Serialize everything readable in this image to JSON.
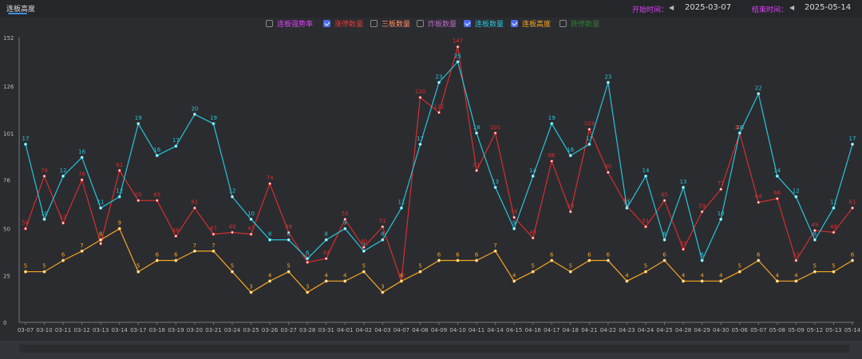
{
  "header": {
    "tab_label": "连板高度",
    "start_label": "开始时间：",
    "start_value": "2025-03-07",
    "end_label": "结束时间：",
    "end_value": "2025-05-14",
    "prev_icon": "caret-left-icon",
    "next_icon": "caret-right-icon"
  },
  "legend": [
    {
      "label": "连板强势率",
      "checked": false,
      "color": "#e040fb"
    },
    {
      "label": "涨停数量",
      "checked": true,
      "color": "#e53935"
    },
    {
      "label": "三板数量",
      "checked": false,
      "color": "#ff8a65"
    },
    {
      "label": "炸板数量",
      "checked": false,
      "color": "#ba68c8"
    },
    {
      "label": "连板数量",
      "checked": true,
      "color": "#26c6da"
    },
    {
      "label": "连板高度",
      "checked": true,
      "color": "#f5a623"
    },
    {
      "label": "跌停数量",
      "checked": false,
      "color": "#2e7d32"
    }
  ],
  "chart_data": {
    "type": "line",
    "ylim": [
      0,
      152
    ],
    "yticks": [
      "0",
      "25",
      "50",
      "76",
      "101",
      "126",
      "152"
    ],
    "grid": false,
    "categories": [
      "03-07",
      "03-10",
      "03-11",
      "03-12",
      "03-13",
      "03-14",
      "03-17",
      "03-18",
      "03-19",
      "03-20",
      "03-21",
      "03-24",
      "03-25",
      "03-26",
      "03-27",
      "03-28",
      "03-31",
      "04-01",
      "04-02",
      "04-03",
      "04-07",
      "04-08",
      "04-09",
      "04-10",
      "04-11",
      "04-14",
      "04-15",
      "04-16",
      "04-17",
      "04-18",
      "04-21",
      "04-22",
      "04-23",
      "04-24",
      "04-25",
      "04-28",
      "04-29",
      "04-30",
      "05-06",
      "05-07",
      "05-08",
      "05-09",
      "05-12",
      "05-13",
      "05-14"
    ],
    "series": [
      {
        "name": "涨停数量",
        "color": "#d32f2f",
        "values": [
          50,
          78,
          53,
          76,
          42,
          81,
          65,
          65,
          46,
          61,
          47,
          48,
          47,
          74,
          48,
          32,
          34,
          55,
          40,
          51,
          22,
          120,
          112,
          147,
          81,
          101,
          56,
          45,
          86,
          59,
          103,
          80,
          62,
          51,
          65,
          39,
          59,
          71,
          101,
          64,
          66,
          33,
          49,
          48,
          61
        ]
      },
      {
        "name": "连板数量",
        "color": "#26c6da",
        "values": [
          17,
          10,
          12,
          16,
          11,
          12,
          19,
          16,
          17,
          20,
          19,
          12,
          10,
          8,
          8,
          6,
          8,
          9,
          7,
          8,
          11,
          17,
          23,
          25,
          18,
          13,
          9,
          14,
          19,
          16,
          17,
          23,
          11,
          14,
          8,
          13,
          6,
          10,
          18,
          22,
          14,
          12,
          8,
          11,
          17
        ],
        "plot_values": [
          95,
          55,
          78,
          88,
          61,
          67,
          106,
          89,
          94,
          111,
          106,
          67,
          55,
          44,
          44,
          34,
          44,
          50,
          38,
          44,
          61,
          95,
          128,
          139,
          101,
          72,
          50,
          78,
          106,
          89,
          95,
          128,
          61,
          78,
          44,
          72,
          33,
          55,
          101,
          122,
          78,
          67,
          44,
          61,
          95
        ]
      },
      {
        "name": "连板高度",
        "color": "#f5a623",
        "values": [
          5,
          5,
          6,
          7,
          8,
          9,
          5,
          6,
          6,
          7,
          7,
          5,
          3,
          4,
          5,
          3,
          4,
          4,
          5,
          3,
          4,
          5,
          6,
          6,
          6,
          7,
          4,
          5,
          6,
          5,
          6,
          6,
          4,
          5,
          6,
          4,
          4,
          4,
          5,
          6,
          4,
          4,
          5,
          5,
          6
        ],
        "plot_values": [
          27,
          27,
          33,
          38,
          44,
          50,
          27,
          33,
          33,
          38,
          38,
          27,
          16,
          22,
          27,
          16,
          22,
          22,
          27,
          16,
          22,
          27,
          33,
          33,
          33,
          38,
          22,
          27,
          33,
          27,
          33,
          33,
          22,
          27,
          33,
          22,
          22,
          22,
          27,
          33,
          22,
          22,
          27,
          27,
          33
        ]
      }
    ]
  }
}
